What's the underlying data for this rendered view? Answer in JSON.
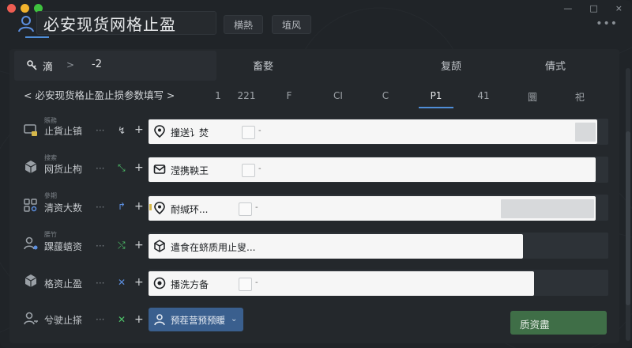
{
  "window": {
    "title": "必安现货网格止盈",
    "controls": [
      "—",
      "□",
      "×"
    ],
    "menu_dots": "•••",
    "traffic_colors": [
      "#ee5d52",
      "#f2b32d",
      "#3fc23f"
    ]
  },
  "tabs": [
    {
      "label": "横熱"
    },
    {
      "label": "埴风"
    }
  ],
  "filter": {
    "icon": "key-icon",
    "label": "滴",
    "arrow": ">",
    "value": "-2"
  },
  "column_headers": [
    "畜婺",
    "复颉",
    "倩式"
  ],
  "breadcrumb": "< 必安现货格止盈止损参数填写 >",
  "number_row": {
    "items": [
      "1",
      "221",
      "F",
      "CI",
      "C",
      "P1",
      "41",
      "圜",
      "祀"
    ],
    "active": "P1"
  },
  "rows": [
    {
      "small": "賬務",
      "label": "止貨止镇",
      "dots": "···",
      "glyph": "↯",
      "plus": "+",
      "row_icon": "monitor-lock-icon",
      "field_icon": "location-pin-icon",
      "field_text": "撞送讠焚",
      "has_check": true,
      "dash": "-"
    },
    {
      "small": "搜索",
      "label": "网货止枸",
      "dots": "···",
      "glyph": "⤡",
      "plus": "+",
      "row_icon": "cube-icon",
      "field_icon": "envelope-icon",
      "field_text": "滢携鞅王",
      "has_check": true,
      "dash": "-"
    },
    {
      "small": "參期",
      "label": "清资大数",
      "dots": "···",
      "glyph": "↱",
      "plus": "+",
      "row_icon": "grid-search-icon",
      "field_icon": "location-pin-icon",
      "field_text": "耐缄环...",
      "has_check": true,
      "dash": "-"
    },
    {
      "small": "腰竹",
      "label": "踝蘐蟢资",
      "dots": "···",
      "glyph": "⤭",
      "plus": "+",
      "row_icon": "user-gear-icon",
      "field_icon": "cube-outline-icon",
      "field_text": "遣食在蛴质用止叟...",
      "has_check": false,
      "dash": ""
    },
    {
      "small": "",
      "label": "格资止盈",
      "dots": "···",
      "glyph": "✕",
      "plus": "+",
      "row_icon": "box-icon",
      "field_icon": "gear-circle-icon",
      "field_text": "播洗方备",
      "has_check": true,
      "dash": "-"
    },
    {
      "small": "",
      "label": "兮驶止搽",
      "dots": "···",
      "glyph": "✕",
      "plus": "+",
      "row_icon": "user-key-icon",
      "field_icon": "",
      "field_text": "",
      "has_check": false,
      "dash": ""
    }
  ],
  "dropdown": {
    "icon": "user-icon",
    "label": "预茬营预预䁔",
    "chevron": "⌄"
  },
  "primary_button": {
    "label": "质资盡"
  },
  "colors": {
    "accent": "#4f8ed8",
    "primary": "#3f6e47",
    "dropdown": "#3a5f8e",
    "icon_green": "#4ec36a",
    "icon_blue": "#5c8fe0",
    "icon_red": "#e06060",
    "warning": "#d6b84a"
  }
}
